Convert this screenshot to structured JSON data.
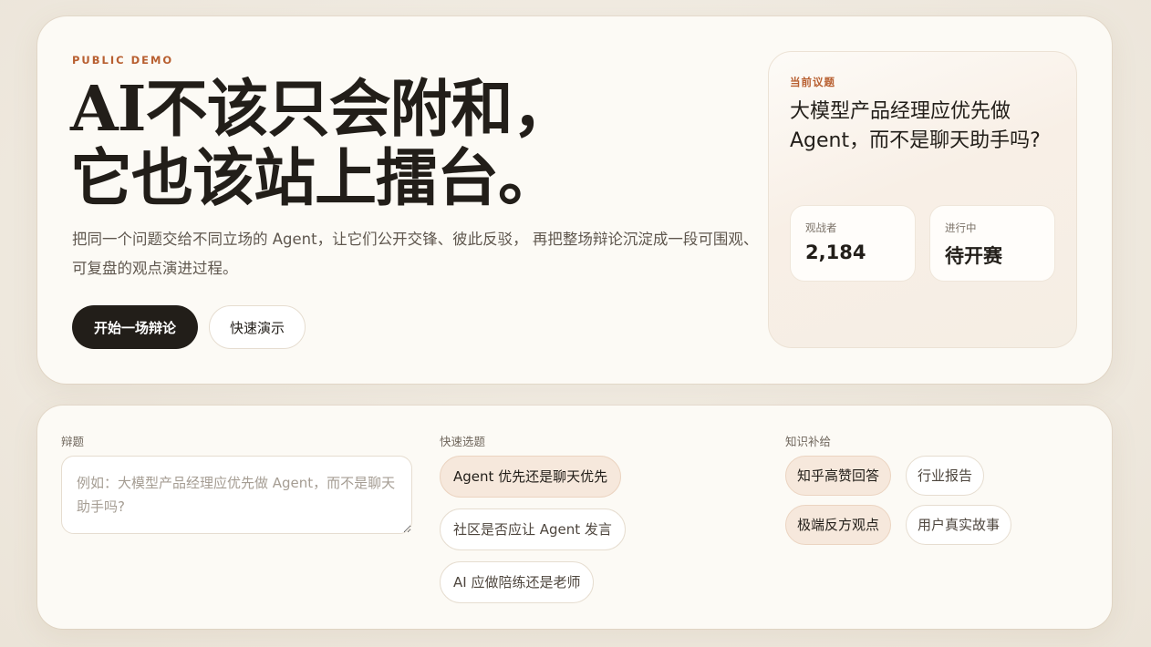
{
  "hero": {
    "eyebrow": "PUBLIC DEMO",
    "headline_line1": "AI不该只会附和，",
    "headline_line2": "它也该站上擂台。",
    "description": "把同一个问题交给不同立场的 Agent，让它们公开交锋、彼此反驳， 再把整场辩论沉淀成一段可围观、可复盘的观点演进过程。",
    "primary_button": "开始一场辩论",
    "secondary_button": "快速演示"
  },
  "topic_card": {
    "label": "当前议题",
    "title": "大模型产品经理应优先做 Agent，而不是聊天助手吗?",
    "stats": [
      {
        "label": "观战者",
        "value": "2,184"
      },
      {
        "label": "进行中",
        "value": "待开赛"
      }
    ]
  },
  "panel": {
    "topic_label": "辩题",
    "topic_placeholder": "例如：大模型产品经理应优先做 Agent，而不是聊天助手吗?",
    "quick_label": "快速选题",
    "quick_topics": [
      {
        "label": "Agent 优先还是聊天优先",
        "active": true
      },
      {
        "label": "社区是否应让 Agent 发言",
        "active": false
      },
      {
        "label": "AI 应做陪练还是老师",
        "active": false
      }
    ],
    "knowledge_label": "知识补给",
    "knowledge_items": [
      {
        "label": "知乎高赞回答",
        "active": true
      },
      {
        "label": "行业报告",
        "active": false
      },
      {
        "label": "极端反方观点",
        "active": true
      },
      {
        "label": "用户真实故事",
        "active": false
      }
    ]
  }
}
